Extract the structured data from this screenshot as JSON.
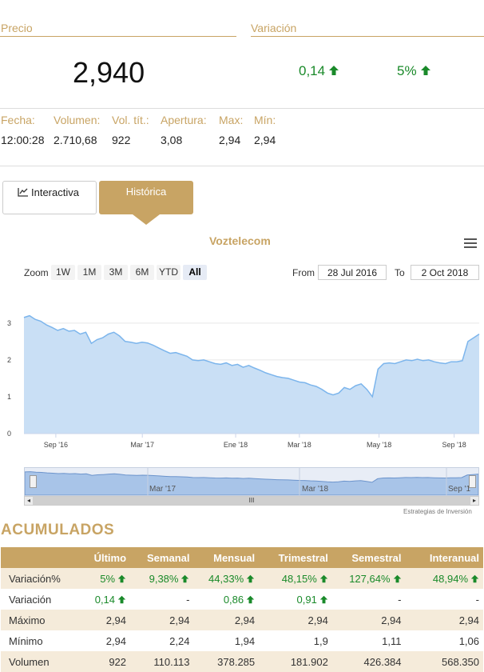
{
  "header": {
    "price_label": "Precio",
    "variation_label": "Variación",
    "price": "2,940",
    "variation_abs": "0,14",
    "variation_pct": "5%"
  },
  "stats": {
    "labels": [
      "Fecha:",
      "Volumen:",
      "Vol. tít.:",
      "Apertura:",
      "Max:",
      "Mín:"
    ],
    "values": [
      "12:00:28",
      "2.710,68",
      "922",
      "3,08",
      "2,94",
      "2,94"
    ]
  },
  "tabs": [
    {
      "label": "Interactiva",
      "active": false
    },
    {
      "label": "Histórica",
      "active": true
    }
  ],
  "chart": {
    "title": "Voztelecom",
    "zoom_label": "Zoom",
    "zoom_buttons": [
      "1W",
      "1M",
      "3M",
      "6M",
      "YTD",
      "All"
    ],
    "zoom_active": "All",
    "from_label": "From",
    "from_value": "28 Jul 2016",
    "to_label": "To",
    "to_value": "2 Oct 2018",
    "credits": "Estrategias de Inversión",
    "navigator_labels": [
      "Mar '17",
      "Mar '18",
      "Sep '1"
    ],
    "scrollbar_grip": "III"
  },
  "chart_data": {
    "type": "area",
    "title": "Voztelecom",
    "x_ticks": [
      "Sep '16",
      "Mar '17",
      "Ene '18",
      "Mar '18",
      "May '18",
      "Sep '18"
    ],
    "y_ticks": [
      0,
      1,
      2,
      3
    ],
    "ylim": [
      0,
      3.3
    ],
    "grid": true,
    "series": [
      {
        "values": [
          3.15,
          3.2,
          3.1,
          3.05,
          2.95,
          2.88,
          2.8,
          2.85,
          2.78,
          2.8,
          2.7,
          2.75,
          2.45,
          2.55,
          2.6,
          2.7,
          2.75,
          2.65,
          2.5,
          2.48,
          2.45,
          2.48,
          2.46,
          2.4,
          2.32,
          2.25,
          2.18,
          2.2,
          2.15,
          2.1,
          2.0,
          1.98,
          2.0,
          1.95,
          1.9,
          1.88,
          1.92,
          1.85,
          1.88,
          1.8,
          1.85,
          1.78,
          1.72,
          1.65,
          1.6,
          1.55,
          1.52,
          1.5,
          1.45,
          1.4,
          1.38,
          1.32,
          1.28,
          1.2,
          1.1,
          1.05,
          1.1,
          1.25,
          1.2,
          1.3,
          1.35,
          1.2,
          1.0,
          1.75,
          1.9,
          1.92,
          1.9,
          1.95,
          2.0,
          1.98,
          2.02,
          1.98,
          2.0,
          1.95,
          1.92,
          1.9,
          1.95,
          1.95,
          1.98,
          2.5,
          2.6,
          2.7
        ]
      }
    ]
  },
  "acumulados": {
    "title": "ACUMULADOS",
    "columns": [
      "",
      "Último",
      "Semanal",
      "Mensual",
      "Trimestral",
      "Semestral",
      "Interanual"
    ],
    "rows": [
      {
        "label": "Variación%",
        "cells": [
          "5%",
          "9,38%",
          "44,33%",
          "48,15%",
          "127,64%",
          "48,94%"
        ],
        "green": [
          true,
          true,
          true,
          true,
          true,
          true
        ]
      },
      {
        "label": "Variación",
        "cells": [
          "0,14",
          "-",
          "0,86",
          "0,91",
          "-",
          "-"
        ],
        "green": [
          true,
          false,
          true,
          true,
          false,
          false
        ]
      },
      {
        "label": "Máximo",
        "cells": [
          "2,94",
          "2,94",
          "2,94",
          "2,94",
          "2,94",
          "2,94"
        ],
        "green": [
          false,
          false,
          false,
          false,
          false,
          false
        ]
      },
      {
        "label": "Mínimo",
        "cells": [
          "2,94",
          "2,24",
          "1,94",
          "1,9",
          "1,11",
          "1,06"
        ],
        "green": [
          false,
          false,
          false,
          false,
          false,
          false
        ]
      },
      {
        "label": "Volumen",
        "cells": [
          "922",
          "110.113",
          "378.285",
          "181.902",
          "426.384",
          "568.350"
        ],
        "green": [
          false,
          false,
          false,
          false,
          false,
          false
        ]
      }
    ]
  },
  "colors": {
    "accent": "#c8a464",
    "positive": "#1a8a2a",
    "series": "#7cb5ec"
  }
}
